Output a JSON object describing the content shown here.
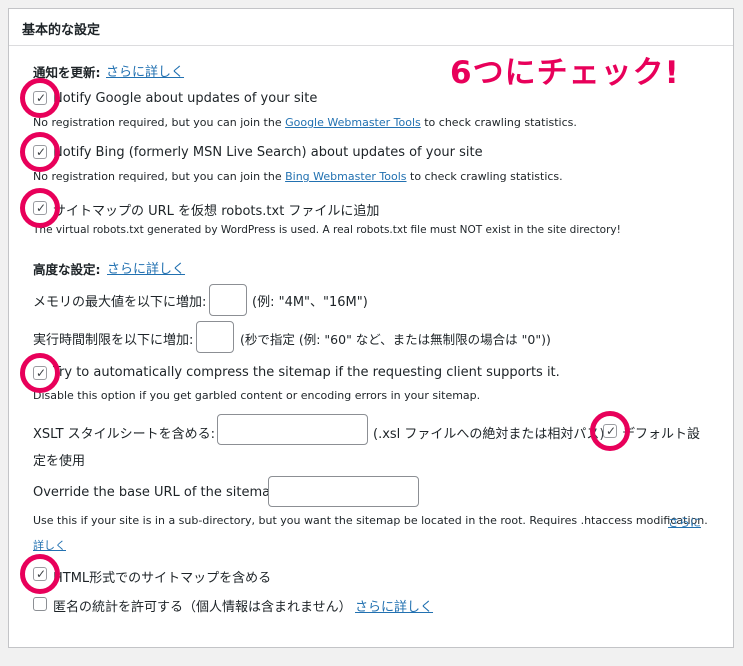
{
  "panel": {
    "title": "基本的な設定"
  },
  "annotation": {
    "text": "6つにチェック!",
    "color": "#e8005a"
  },
  "notify": {
    "heading": "通知を更新:",
    "more_link": "さらに詳しく",
    "google": {
      "label": "Notify Google about updates of your site",
      "checked": true,
      "desc_prefix": "No registration required, but you can join the ",
      "desc_link": "Google Webmaster Tools",
      "desc_suffix": " to check crawling statistics."
    },
    "bing": {
      "label": "Notify Bing (formerly MSN Live Search) about updates of your site",
      "checked": true,
      "desc_prefix": "No registration required, but you can join the ",
      "desc_link": "Bing Webmaster Tools",
      "desc_suffix": " to check crawling statistics."
    },
    "robots": {
      "label": "サイトマップの URL を仮想 robots.txt ファイルに追加",
      "checked": true,
      "desc": "The virtual robots.txt generated by WordPress is used. A real robots.txt file must NOT exist in the site directory!"
    }
  },
  "advanced": {
    "heading": "高度な設定:",
    "more_link": "さらに詳しく",
    "memory": {
      "label": "メモリの最大値を以下に増加:",
      "value": "",
      "hint": "(例: \"4M\"、\"16M\")"
    },
    "time": {
      "label": "実行時間制限を以下に増加:",
      "value": "",
      "hint": "(秒で指定 (例: \"60\" など、または無制限の場合は \"0\"))"
    },
    "compress": {
      "label": "Try to automatically compress the sitemap if the requesting client supports it.",
      "checked": true,
      "desc": "Disable this option if you get garbled content or encoding errors in your sitemap."
    },
    "xslt": {
      "label": "XSLT スタイルシートを含める:",
      "value": "",
      "hint": "(.xsl ファイルへの絶対または相対パス)",
      "default_label_1": "デフォルト設",
      "default_label_2": "定を使用",
      "default_checked": true
    },
    "baseurl": {
      "label": "Override the base URL of the sitemap:",
      "value": "",
      "desc": "Use this if your site is in a sub-directory, but you want the sitemap be located in the root. Requires .htaccess modification.",
      "more_link_1": "さらに",
      "more_link_2": "詳しく"
    },
    "html": {
      "label": "HTML形式でのサイトマップを含める",
      "checked": true
    },
    "stats": {
      "label": "匿名の統計を許可する（個人情報は含まれません）",
      "checked": false,
      "more_link": "さらに詳しく"
    }
  }
}
